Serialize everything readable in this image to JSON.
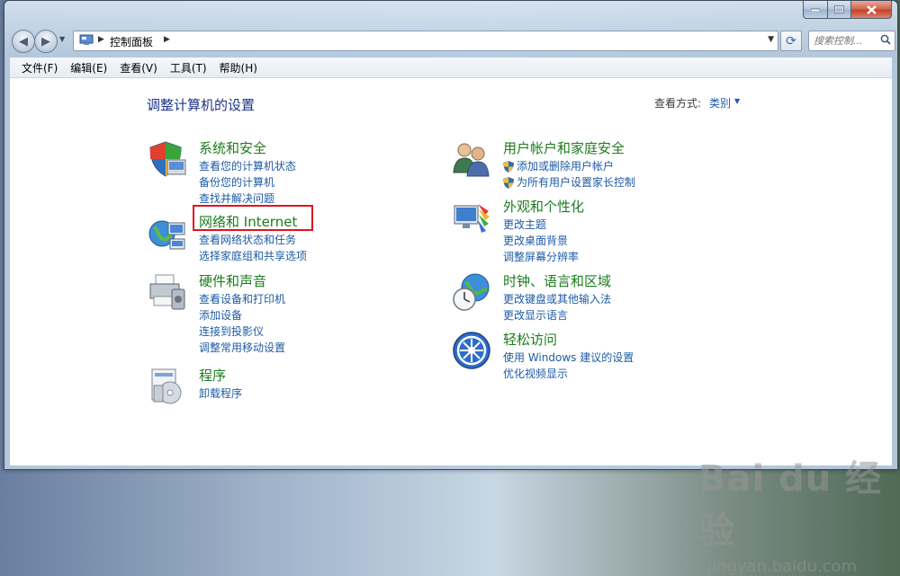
{
  "window": {
    "caption_buttons": [
      "minimize",
      "maximize",
      "close"
    ]
  },
  "address_bar": {
    "path_label": "控制面板",
    "search_placeholder": "搜索控制..."
  },
  "menu": {
    "items": [
      "文件(F)",
      "编辑(E)",
      "查看(V)",
      "工具(T)",
      "帮助(H)"
    ]
  },
  "content": {
    "title": "调整计算机的设置",
    "view_by_label": "查看方式:",
    "view_by_value": "类别",
    "categories_left": [
      {
        "title": "系统和安全",
        "icon": "security-shield-icon",
        "links": [
          "查看您的计算机状态",
          "备份您的计算机",
          "查找并解决问题"
        ]
      },
      {
        "title": "网络和 Internet",
        "icon": "network-icon",
        "links": [
          "查看网络状态和任务",
          "选择家庭组和共享选项"
        ]
      },
      {
        "title": "硬件和声音",
        "icon": "printer-icon",
        "links": [
          "查看设备和打印机",
          "添加设备",
          "连接到投影仪",
          "调整常用移动设置"
        ]
      },
      {
        "title": "程序",
        "icon": "programs-icon",
        "links": [
          "卸载程序"
        ]
      }
    ],
    "categories_right": [
      {
        "title": "用户帐户和家庭安全",
        "icon": "users-icon",
        "links": [
          "添加或删除用户帐户",
          "为所有用户设置家长控制"
        ],
        "shield_links": true
      },
      {
        "title": "外观和个性化",
        "icon": "appearance-icon",
        "links": [
          "更改主题",
          "更改桌面背景",
          "调整屏幕分辨率"
        ]
      },
      {
        "title": "时钟、语言和区域",
        "icon": "clock-globe-icon",
        "links": [
          "更改键盘或其他输入法",
          "更改显示语言"
        ]
      },
      {
        "title": "轻松访问",
        "icon": "ease-of-access-icon",
        "links": [
          "使用 Windows 建议的设置",
          "优化视频显示"
        ]
      }
    ]
  },
  "watermark": {
    "brand": "Bai du 经验",
    "url": "jingyan.baidu.com"
  },
  "colors": {
    "link": "#1e5ba6",
    "category_title": "#1c7c1c",
    "page_title": "#1e3287",
    "highlight": "#e0141e"
  }
}
